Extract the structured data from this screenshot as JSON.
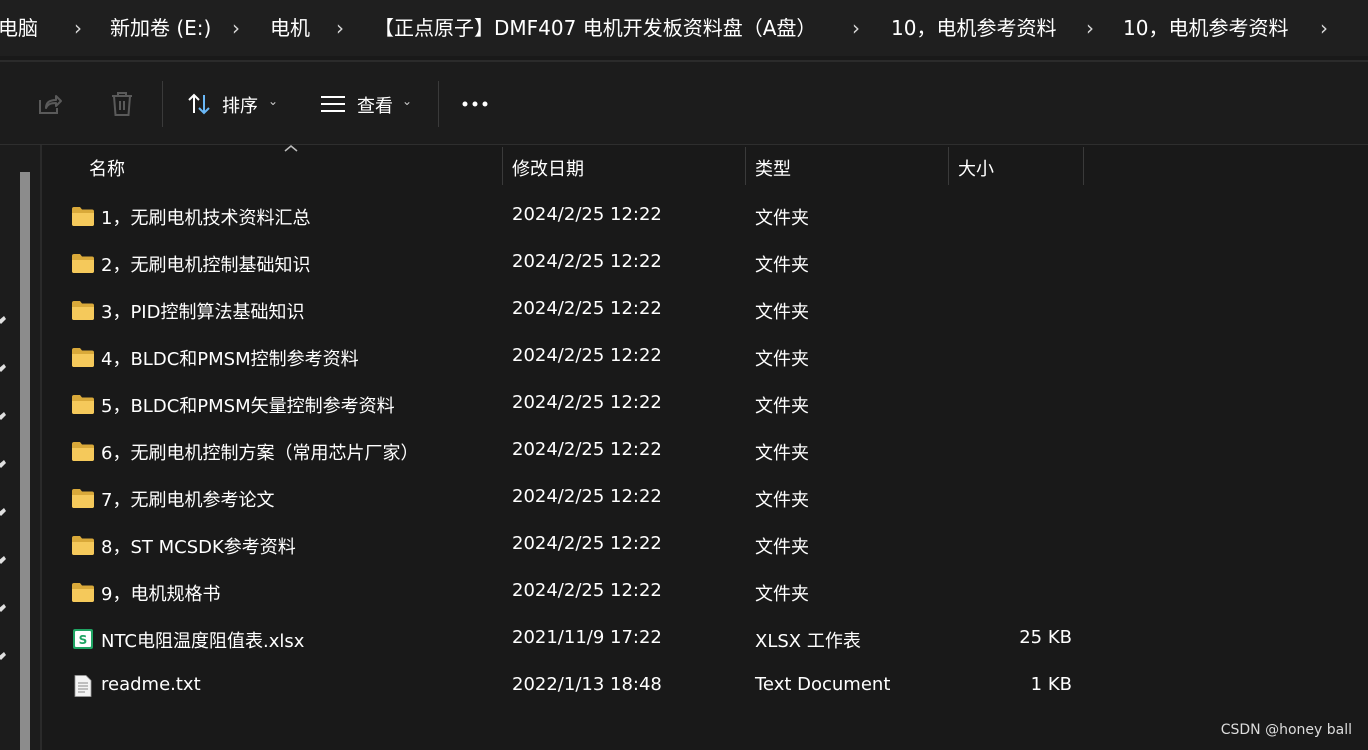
{
  "breadcrumb": {
    "items": [
      "此电脑",
      "新加卷 (E:)",
      "电机",
      "【正点原子】DMF407 电机开发板资料盘（A盘）",
      "10，电机参考资料",
      "10，电机参考资料"
    ]
  },
  "toolbar": {
    "sort_label": "排序",
    "view_label": "查看",
    "more_label": "..."
  },
  "columns": {
    "name": "名称",
    "modified": "修改日期",
    "type": "类型",
    "size": "大小"
  },
  "files": [
    {
      "icon": "folder-icon",
      "name": "1，无刷电机技术资料汇总",
      "modified": "2024/2/25 12:22",
      "type": "文件夹",
      "size": ""
    },
    {
      "icon": "folder-icon",
      "name": "2，无刷电机控制基础知识",
      "modified": "2024/2/25 12:22",
      "type": "文件夹",
      "size": ""
    },
    {
      "icon": "folder-icon",
      "name": "3，PID控制算法基础知识",
      "modified": "2024/2/25 12:22",
      "type": "文件夹",
      "size": ""
    },
    {
      "icon": "folder-icon",
      "name": "4，BLDC和PMSM控制参考资料",
      "modified": "2024/2/25 12:22",
      "type": "文件夹",
      "size": ""
    },
    {
      "icon": "folder-icon",
      "name": "5，BLDC和PMSM矢量控制参考资料",
      "modified": "2024/2/25 12:22",
      "type": "文件夹",
      "size": ""
    },
    {
      "icon": "folder-icon",
      "name": "6，无刷电机控制方案（常用芯片厂家）",
      "modified": "2024/2/25 12:22",
      "type": "文件夹",
      "size": ""
    },
    {
      "icon": "folder-icon",
      "name": "7，无刷电机参考论文",
      "modified": "2024/2/25 12:22",
      "type": "文件夹",
      "size": ""
    },
    {
      "icon": "folder-icon",
      "name": "8，ST MCSDK参考资料",
      "modified": "2024/2/25 12:22",
      "type": "文件夹",
      "size": ""
    },
    {
      "icon": "folder-icon",
      "name": "9，电机规格书",
      "modified": "2024/2/25 12:22",
      "type": "文件夹",
      "size": ""
    },
    {
      "icon": "spreadsheet-icon",
      "name": "NTC电阻温度阻值表.xlsx",
      "modified": "2021/11/9 17:22",
      "type": "XLSX 工作表",
      "size": "25 KB"
    },
    {
      "icon": "text-document-icon",
      "name": "readme.txt",
      "modified": "2022/1/13 18:48",
      "type": "Text Document",
      "size": "1 KB"
    }
  ],
  "watermark": "CSDN @honey ball",
  "colors": {
    "background": "#191919",
    "folder": "#f2c14e",
    "spreadsheet": "#1fa463"
  }
}
